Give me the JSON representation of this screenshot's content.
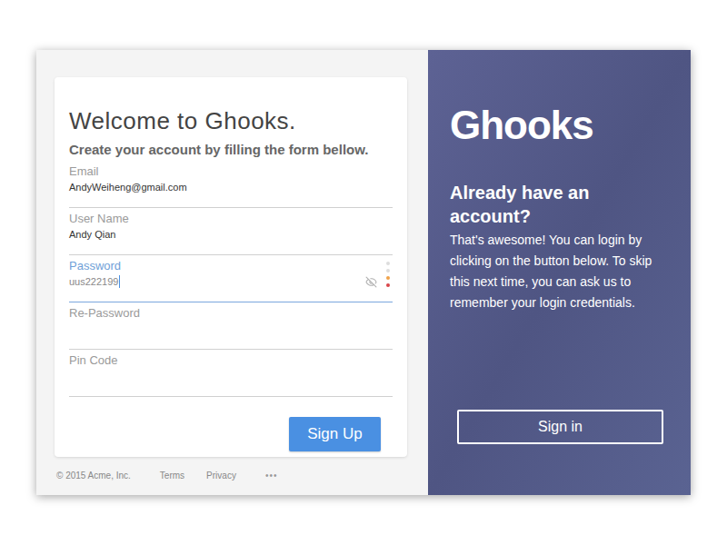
{
  "form": {
    "title": "Welcome to Ghooks.",
    "subtitle": "Create your account by filling the form bellow.",
    "fields": [
      {
        "label": "Email",
        "value": "AndyWeiheng@gmail.com",
        "focused": false,
        "kind": "text"
      },
      {
        "label": "User Name",
        "value": "Andy Qian",
        "focused": false,
        "kind": "text"
      },
      {
        "label": "Password",
        "value": "uus222199",
        "focused": true,
        "kind": "password"
      },
      {
        "label": "Re-Password",
        "value": "",
        "focused": false,
        "kind": "text"
      },
      {
        "label": "Pin Code",
        "value": "",
        "focused": false,
        "kind": "text"
      }
    ],
    "strength": [
      {
        "color": "#dddddd"
      },
      {
        "color": "#dddddd"
      },
      {
        "color": "#f0a24a"
      },
      {
        "color": "#d9464a"
      }
    ],
    "submit": "Sign Up"
  },
  "footer": {
    "copyright": "© 2015 Acme, Inc.",
    "links": [
      "Terms",
      "Privacy"
    ],
    "more": "•••"
  },
  "side": {
    "logo": "Ghooks",
    "heading": "Already have an account?",
    "text": "That's awesome! You can login by clicking on the button below. To skip this next time, you can ask us to remember your login credentials.",
    "button": "Sign in"
  }
}
